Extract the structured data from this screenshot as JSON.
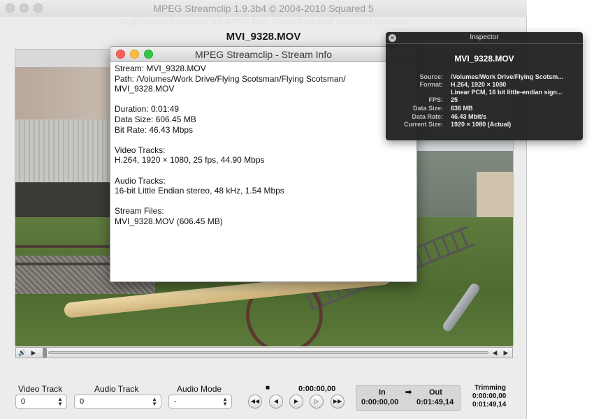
{
  "main": {
    "title": "MPEG Streamclip 1.9.3b4  ©  2004-2010 Squared 5",
    "subtitle": "High-quality converter for MPEG files, QuickTime and transport streams",
    "file_name": "MVI_9328.MOV"
  },
  "controls": {
    "video_track_label": "Video Track",
    "video_track_value": "0",
    "audio_track_label": "Audio Track",
    "audio_track_value": "0",
    "audio_mode_label": "Audio Mode",
    "audio_mode_value": "-",
    "current_time": "0:00:00,00",
    "stop_glyph": "■",
    "in_label": "In",
    "in_time": "0:00:00,00",
    "arrow_glyph": "➡",
    "out_label": "Out",
    "out_time": "0:01:49,14",
    "trimming_label": "Trimming",
    "trimming_start": "0:00:00,00",
    "trimming_end": "0:01:49,14"
  },
  "info_window": {
    "title": "MPEG Streamclip - Stream Info",
    "lines": [
      "Stream: MVI_9328.MOV",
      "Path: /Volumes/Work Drive/Flying Scotsman/Flying Scotsman/",
      "MVI_9328.MOV",
      "",
      "Duration: 0:01:49",
      "Data Size: 606.45 MB",
      "Bit Rate: 46.43 Mbps",
      "",
      "Video Tracks:",
      "H.264, 1920 × 1080, 25 fps, 44.90 Mbps",
      "",
      "Audio Tracks:",
      "16-bit Little Endian stereo, 48 kHz, 1.54 Mbps",
      "",
      "Stream Files:",
      "MVI_9328.MOV (606.45 MB)"
    ]
  },
  "inspector": {
    "title": "Inspector",
    "file_name": "MVI_9328.MOV",
    "rows": [
      {
        "key": "Source:",
        "value": "/Volumes/Work Drive/Flying Scotsm..."
      },
      {
        "key": "Format:",
        "value": "H.264, 1920 × 1080"
      },
      {
        "key": "",
        "value": "Linear PCM, 16 bit little-endian sign..."
      },
      {
        "key": "FPS:",
        "value": "25"
      },
      {
        "key": "Data Size:",
        "value": "636 MB"
      },
      {
        "key": "Data Rate:",
        "value": "46.43 Mbit/s"
      },
      {
        "key": "Current Size:",
        "value": "1920 × 1080 (Actual)"
      }
    ]
  },
  "colors": {
    "close": "#fc605c",
    "minimize": "#fdbc40",
    "zoom": "#34c84a"
  }
}
